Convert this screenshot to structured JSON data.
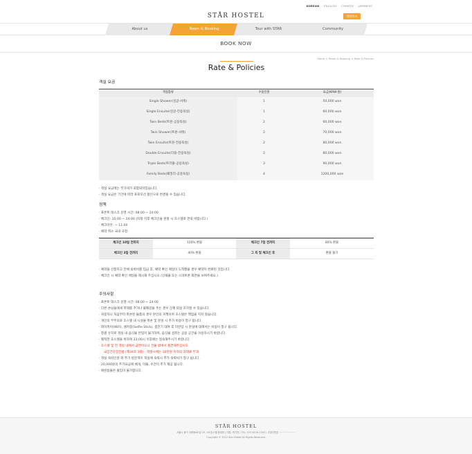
{
  "header": {
    "languages": [
      "KOREAN",
      "ENGLISH",
      "CHINESE",
      "JAPANESE"
    ],
    "logo": "STÅR HOSTEL",
    "reserve_label": "예약하기"
  },
  "nav": {
    "items": [
      {
        "label": "About us"
      },
      {
        "label": "Room & Booking"
      },
      {
        "label": "Tour with STAR"
      },
      {
        "label": "Community"
      }
    ],
    "active_index": 1
  },
  "section_title": "BOOK NOW",
  "breadcrumb": "Home > Room & Booking > Rate & Policies",
  "page_title": "Rate & Policies",
  "rates": {
    "heading": "객실 요금",
    "columns": [
      "객실종류",
      "수용인원",
      "요금(KRW-원)"
    ],
    "rows": [
      [
        "Single Shower(싱글-샤워)",
        "1",
        "50,000 won"
      ],
      [
        "Single Ensuite(싱글-전용욕실)",
        "1",
        "60,000 won"
      ],
      [
        "Twin Beds(트윈-공용욕실)",
        "2",
        "60,000 won"
      ],
      [
        "Twin Shower(트윈-샤워)",
        "2",
        "70,000 won"
      ],
      [
        "Twin Ensuite(트윈-전용욕실)",
        "2",
        "80,000 won"
      ],
      [
        "Double Ensuite(더블-전용욕실)",
        "2",
        "80,000 won"
      ],
      [
        "Triple Beds(트리플-공용욕실)",
        "3",
        "90,000 won"
      ],
      [
        "Family Beds(패밀리-공용욕실)",
        "4",
        "1200,000 won"
      ]
    ],
    "notes": [
      "· 객실 요금에는 부가세가 포함되어있습니다.",
      "· 객실 요금은 기간에 따라 프로모션 할인으로 변경될 수 있습니다."
    ]
  },
  "policy": {
    "heading": "정책",
    "notes": [
      "· 프론트 데스크 운영 시간: 08:00 ~ 24:00",
      "· 체크인: 15:00 ~ 24:00 (자정 이후 체크인을 원할 시 호스텔로 연락 바랍니다.)",
      "· 체크아웃: ~ 11:00",
      "· 예약 취소 국내 규정:"
    ],
    "cancel_table": [
      [
        "체크인 10일 전까지",
        "100% 환불",
        "체크인 7일 전까지",
        "80% 환불"
      ],
      [
        "체크인 3일 전까지",
        "40% 환불",
        "그 외 및 체크인 후",
        "환불 불가"
      ]
    ],
    "after_notes": [
      "· 예약을 신청하고 전체 숙박비를 입금 후, 예약 확인 메일이 도착했을 경우 예약이 완료된 것입니다.",
      "· 체크인 시 예약 확인 메일을 제시해 주십시오.(인쇄물 또는 스마트폰 화면을 보여주세요.)"
    ]
  },
  "cautions": {
    "heading": "주의사항",
    "items": [
      {
        "text": "· 프론트 데스크 운영 시간: 08:00 ~ 24:00",
        "style": "normal"
      },
      {
        "text": "· 다른 손님들에게 피해를 주거나 불쾌감을 주는 경우 강제 퇴실 조치할 수 있습니다.",
        "style": "normal"
      },
      {
        "text": "· 귀중하나 처음부터 파손된 물품의 경우 본인의 귀책이며 호스텔은 책임을 지지 않습니다.",
        "style": "normal"
      },
      {
        "text": "· 개인의 부주의로 호스텔 내 시설물 파손 및 분실 시 추가 비용이 청구 됩니다.",
        "style": "normal"
      },
      {
        "text": "· 와이파이(WiFi), 셀카봉(Selfie Stick), 충전기 대여 후 미반납 시 분실에 대해서는 비용이 청구 됩니다.",
        "style": "normal"
      },
      {
        "text": "· 청결 유지로 객실 내 음식물 반입이 불가하며, 음식물 섭취는 공용 공간을 이용하시기 바랍니다.",
        "style": "normal"
      },
      {
        "text": "· 쾌적한 호스텔을 위하여 23:00시 이후에는 정숙해주시기 바랍니다.",
        "style": "normal"
      },
      {
        "text": "· 호스텔 및 전 객실 내에서 금연이오니 건물 밖에서 흡연해주십시오.",
        "style": "red"
      },
      {
        "text": "국민건강증진법 (제34조 3항) : 적발시에는 10만원 이하의 과태료 부과",
        "style": "red-sub"
      },
      {
        "text": "· 객실 숙박인원 외 추가 방문객이 객실에 숙박시 추가 숙박비가 청구 됩니다.",
        "style": "normal"
      },
      {
        "text": "· 20,000원의 추가요금에 베개, 이불, 수건이 추가 제공 됩니다.",
        "style": "normal"
      },
      {
        "text": "· 애완동물은 출입이 불가합니다.",
        "style": "normal"
      }
    ]
  },
  "footer": {
    "logo": "STÅR HOSTEL",
    "info": "서울시 중구 아현동로5길 29, 스타호스텔 동대문  |  대표: 최기찬  |  TEL: 070-8128-1333  |  사업자번호: ~~~~~~~~",
    "copyright": "Copyright © 2012 Star Hostel All Rights Reserved."
  },
  "colors": {
    "accent": "#f4a334",
    "warning": "#e0341e"
  }
}
